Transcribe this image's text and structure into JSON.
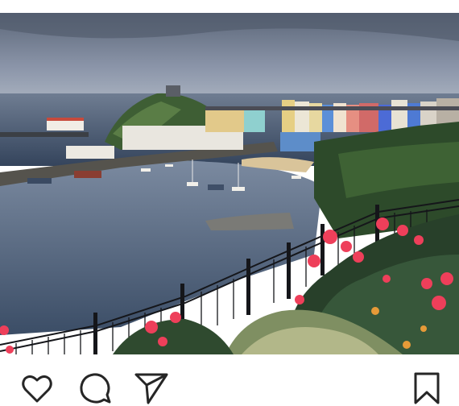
{
  "post": {
    "photo_icon": "photo",
    "actions": {
      "like_icon": "heart-icon",
      "comment_icon": "comment-icon",
      "share_icon": "paper-plane-icon",
      "save_icon": "bookmark-icon"
    }
  },
  "colors": {
    "icon_stroke": "#262626",
    "background": "#ffffff"
  }
}
